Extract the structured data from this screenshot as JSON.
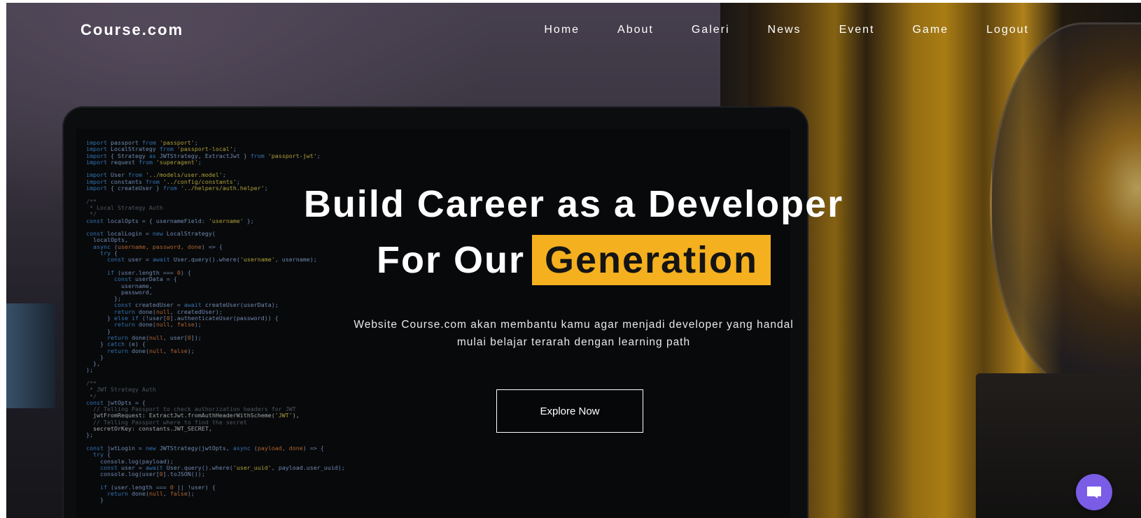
{
  "brand": {
    "name": "Course.com"
  },
  "nav": {
    "items": [
      {
        "label": "Home"
      },
      {
        "label": "About"
      },
      {
        "label": "Galeri"
      },
      {
        "label": "News"
      },
      {
        "label": "Event"
      },
      {
        "label": "Game"
      },
      {
        "label": "Logout"
      }
    ]
  },
  "hero": {
    "title_line1": "Build Career as a Developer",
    "title_line2_prefix": "For Our",
    "title_line2_highlight": "Generation",
    "subtitle_line1": "Website Course.com akan membantu kamu agar menjadi developer yang handal",
    "subtitle_line2": "mulai belajar terarah dengan learning path",
    "cta_label": "Explore Now"
  },
  "colors": {
    "highlight": "#f4b01e",
    "chat_button": "#7a5ce6",
    "text": "#ffffff"
  },
  "icons": {
    "chat": "chat-bubble-icon"
  }
}
